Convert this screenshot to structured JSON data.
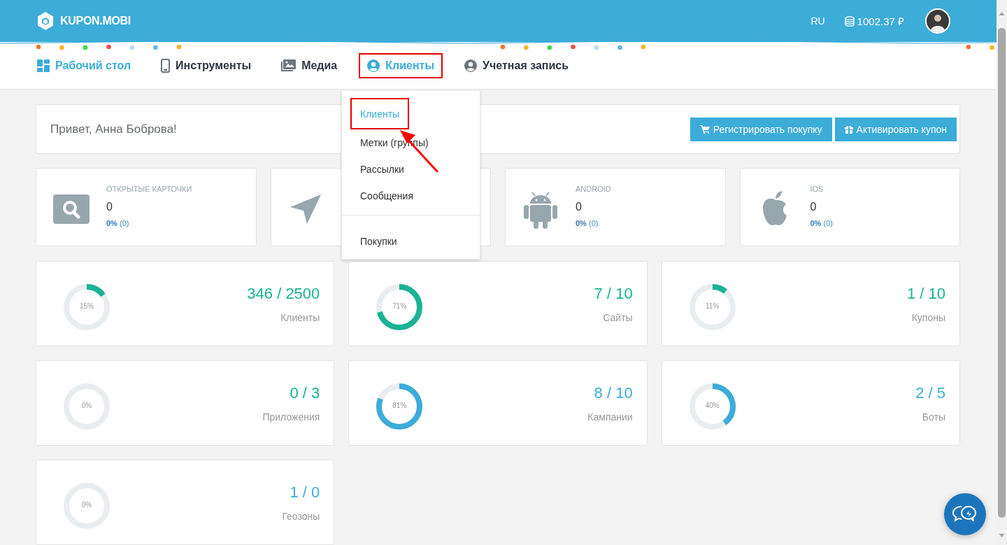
{
  "header": {
    "logo": "KUPON.MOBI",
    "language": "RU",
    "balance": "1002.37 ₽"
  },
  "nav": [
    {
      "label": "Рабочий стол",
      "selected": true,
      "highlighted": false
    },
    {
      "label": "Инструменты",
      "selected": false,
      "highlighted": false
    },
    {
      "label": "Медиа",
      "selected": false,
      "highlighted": false
    },
    {
      "label": "Клиенты",
      "selected": true,
      "highlighted": true
    },
    {
      "label": "Учетная запись",
      "selected": false,
      "highlighted": false
    }
  ],
  "dropdown": {
    "groups": [
      [
        {
          "label": "Клиенты",
          "selected": true,
          "highlighted": true
        },
        {
          "label": "Метки (группы)",
          "selected": false,
          "highlighted": false
        },
        {
          "label": "Рассылки",
          "selected": false,
          "highlighted": false
        },
        {
          "label": "Сообщения",
          "selected": false,
          "highlighted": false
        }
      ],
      [
        {
          "label": "Покупки",
          "selected": false,
          "highlighted": false
        }
      ]
    ],
    "arrow": true
  },
  "greeting": "Привет, Анна Боброва!",
  "actions": [
    {
      "label": "Регистрировать покупку"
    },
    {
      "label": "Активировать купон"
    }
  ],
  "stats": [
    {
      "kind": "search",
      "label": "ОТКРЫТЫЕ КАРТОЧКИ",
      "value": "0",
      "share": "**0%** (0)"
    },
    {
      "kind": "send"
    },
    {
      "kind": "android",
      "label": "ANDROID",
      "value": "0",
      "share": "**0%** (0)"
    },
    {
      "kind": "apple",
      "label": "IOS",
      "value": "0",
      "share": "**0%** (0)"
    }
  ],
  "rings": [
    {
      "percent": "15%",
      "level": 0.15,
      "count": "346 / 2500",
      "label": "Клиенты",
      "color": "#1ab394"
    },
    {
      "percent": "71%",
      "level": 0.71,
      "count": "7 / 10",
      "label": "Сайты",
      "color": "#1ab394"
    },
    {
      "percent": "11%",
      "level": 0.11,
      "count": "1 / 10",
      "label": "Купоны",
      "color": "#1ab394"
    },
    {
      "percent": "0%",
      "level": 0,
      "count": "0 / 3",
      "label": "Приложения",
      "color": "#1ab394"
    },
    {
      "percent": "81%",
      "level": 0.81,
      "count": "8 / 10",
      "label": "Кампании",
      "color": "#3cacd9"
    },
    {
      "percent": "40%",
      "level": 0.4,
      "count": "2 / 5",
      "label": "Боты",
      "color": "#3cacd9"
    },
    {
      "percent": "0%",
      "level": 0,
      "count": "1 / 0",
      "label": "Геозоны",
      "color": "#3cacd9"
    }
  ]
}
